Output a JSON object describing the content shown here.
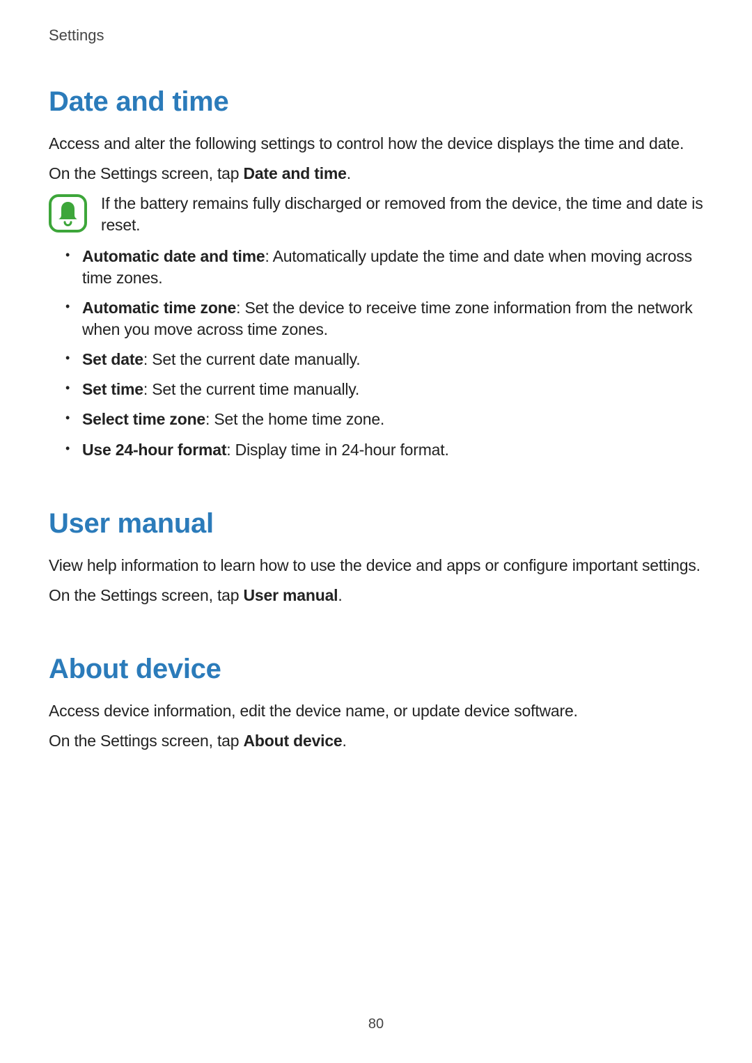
{
  "header": {
    "running": "Settings"
  },
  "footer": {
    "page_number": "80"
  },
  "sections": {
    "date_time": {
      "heading": "Date and time",
      "intro": "Access and alter the following settings to control how the device displays the time and date.",
      "nav_prefix": "On the Settings screen, tap ",
      "nav_bold": "Date and time",
      "nav_suffix": ".",
      "note": "If the battery remains fully discharged or removed from the device, the time and date is reset.",
      "note_icon": "bell-icon",
      "bullets": [
        {
          "bold": "Automatic date and time",
          "rest": ": Automatically update the time and date when moving across time zones."
        },
        {
          "bold": "Automatic time zone",
          "rest": ": Set the device to receive time zone information from the network when you move across time zones."
        },
        {
          "bold": "Set date",
          "rest": ": Set the current date manually."
        },
        {
          "bold": "Set time",
          "rest": ": Set the current time manually."
        },
        {
          "bold": "Select time zone",
          "rest": ": Set the home time zone."
        },
        {
          "bold": "Use 24-hour format",
          "rest": ": Display time in 24-hour format."
        }
      ]
    },
    "user_manual": {
      "heading": "User manual",
      "intro": "View help information to learn how to use the device and apps or configure important settings.",
      "nav_prefix": "On the Settings screen, tap ",
      "nav_bold": "User manual",
      "nav_suffix": "."
    },
    "about_device": {
      "heading": "About device",
      "intro": "Access device information, edit the device name, or update device software.",
      "nav_prefix": "On the Settings screen, tap ",
      "nav_bold": "About device",
      "nav_suffix": "."
    }
  }
}
